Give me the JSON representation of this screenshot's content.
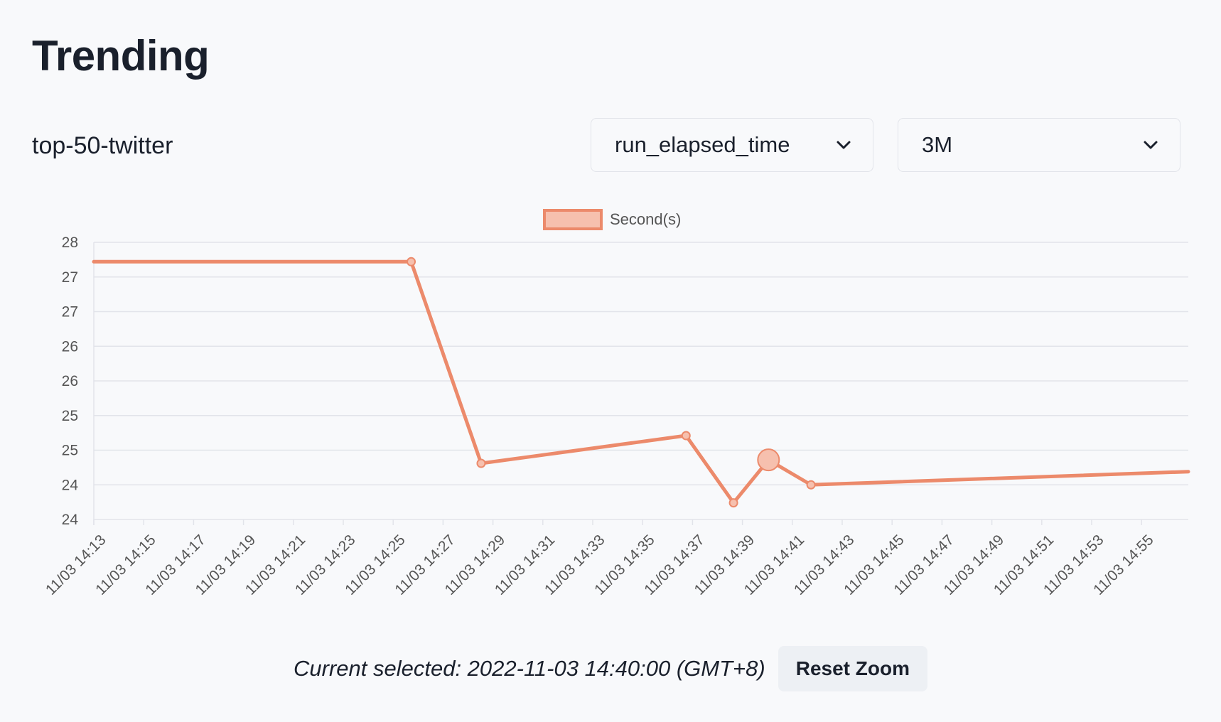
{
  "page": {
    "title": "Trending",
    "project_name": "top-50-twitter"
  },
  "controls": {
    "metric_select": {
      "value": "run_elapsed_time"
    },
    "range_select": {
      "value": "3M"
    }
  },
  "footer": {
    "current_selected": "Current selected: 2022-11-03 14:40:00 (GMT+8)",
    "reset_zoom_label": "Reset Zoom"
  },
  "icons": {
    "dropdown": "chevron-down-icon"
  },
  "chart_data": {
    "type": "line",
    "legend": {
      "label": "Second(s)",
      "placement": "top-center"
    },
    "colors": {
      "line": "#ec8a6b",
      "fill": "#f6c0ae",
      "grid": "#e2e4ea",
      "axis_text": "#555555"
    },
    "x_tick_labels": [
      "11/03 14:13",
      "11/03 14:15",
      "11/03 14:17",
      "11/03 14:19",
      "11/03 14:21",
      "11/03 14:23",
      "11/03 14:25",
      "11/03 14:27",
      "11/03 14:29",
      "11/03 14:31",
      "11/03 14:33",
      "11/03 14:35",
      "11/03 14:37",
      "11/03 14:39",
      "11/03 14:41",
      "11/03 14:43",
      "11/03 14:45",
      "11/03 14:47",
      "11/03 14:49",
      "11/03 14:51",
      "11/03 14:53",
      "11/03 14:55"
    ],
    "x_range_minutes": [
      13,
      56.8
    ],
    "y_tick_labels": [
      "28",
      "27",
      "27",
      "26",
      "26",
      "25",
      "25",
      "24",
      "24"
    ],
    "y_range": [
      23.9,
      27.9
    ],
    "series": [
      {
        "name": "Second(s)",
        "points": [
          {
            "t": "14:13",
            "minute": 13.0,
            "value": 27.62,
            "marker": false
          },
          {
            "t": "14:25:40",
            "minute": 25.7,
            "value": 27.62,
            "marker": true
          },
          {
            "t": "14:28:30",
            "minute": 28.5,
            "value": 24.71,
            "marker": true
          },
          {
            "t": "14:36:40",
            "minute": 36.7,
            "value": 25.11,
            "marker": true
          },
          {
            "t": "14:38:40",
            "minute": 38.6,
            "value": 24.14,
            "marker": true
          },
          {
            "t": "14:40:00",
            "minute": 40.0,
            "value": 24.76,
            "marker": true,
            "selected": true
          },
          {
            "t": "14:41:40",
            "minute": 41.7,
            "value": 24.4,
            "marker": true
          },
          {
            "t": "14:56:48",
            "minute": 56.8,
            "value": 24.59,
            "marker": false
          }
        ]
      }
    ],
    "grid": true
  }
}
